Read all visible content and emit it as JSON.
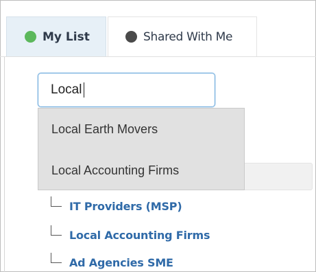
{
  "colors": {
    "my_list_dot": "#5cb85c",
    "shared_dot": "#4a4a4a",
    "link": "#2f6aa8",
    "active_tab_bg": "#e7f0f7",
    "dropdown_bg": "#e1e1e1"
  },
  "tabs": {
    "my_list": {
      "label": "My List"
    },
    "shared": {
      "label": "Shared With Me"
    }
  },
  "search": {
    "value": "Local"
  },
  "dropdown": {
    "items": [
      {
        "label": "Local Earth Movers"
      },
      {
        "label": "Local Accounting Firms"
      }
    ]
  },
  "tree": {
    "items": [
      {
        "label": "IT Providers (MSP)"
      },
      {
        "label": "Local Accounting Firms"
      },
      {
        "label": "Ad Agencies SME"
      }
    ]
  }
}
